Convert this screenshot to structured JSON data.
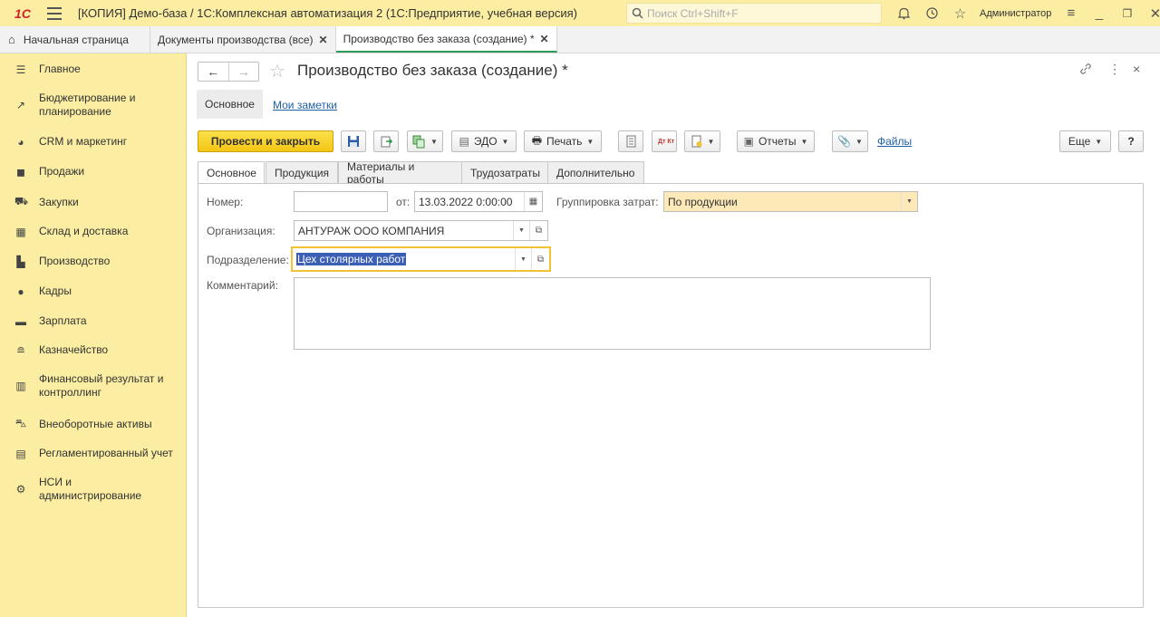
{
  "titlebar": {
    "logo": "1С",
    "title": "[КОПИЯ] Демо-база / 1С:Комплексная автоматизация 2  (1С:Предприятие, учебная версия)",
    "search_placeholder": "Поиск Ctrl+Shift+F",
    "username": "Администратор"
  },
  "tabs": [
    {
      "label": "Начальная страница"
    },
    {
      "label": "Документы производства (все)"
    },
    {
      "label": "Производство без заказа (создание) *"
    }
  ],
  "sidebar": {
    "items": [
      {
        "label": "Главное",
        "icon": "menu-lines-icon"
      },
      {
        "label": "Бюджетирование и планирование",
        "icon": "budget-chart-icon"
      },
      {
        "label": "CRM и маркетинг",
        "icon": "pie-chart-icon"
      },
      {
        "label": "Продажи",
        "icon": "shopping-bag-icon"
      },
      {
        "label": "Закупки",
        "icon": "cart-icon"
      },
      {
        "label": "Склад и доставка",
        "icon": "warehouse-grid-icon"
      },
      {
        "label": "Производство",
        "icon": "factory-icon"
      },
      {
        "label": "Кадры",
        "icon": "person-icon"
      },
      {
        "label": "Зарплата",
        "icon": "money-card-icon"
      },
      {
        "label": "Казначейство",
        "icon": "coins-icon"
      },
      {
        "label": "Финансовый результат и контроллинг",
        "icon": "bar-chart-icon"
      },
      {
        "label": "Внеоборотные активы",
        "icon": "car-icon"
      },
      {
        "label": "Регламентированный учет",
        "icon": "ledger-icon"
      },
      {
        "label": "НСИ и администрирование",
        "icon": "gear-icon"
      }
    ]
  },
  "form": {
    "title": "Производство без заказа (создание) *",
    "subnav_main": "Основное",
    "subnav_notes": "Мои заметки",
    "toolbar": {
      "post_close": "Провести и закрыть",
      "edo": "ЭДО",
      "print": "Печать",
      "reports": "Отчеты",
      "files": "Файлы",
      "more": "Еще",
      "help": "?",
      "dt_kt": "Дт Кт"
    },
    "tabs": [
      "Основное",
      "Продукция",
      "Материалы и работы",
      "Трудозатраты",
      "Дополнительно"
    ],
    "fields": {
      "number_label": "Номер:",
      "number_value": "",
      "date_label": "от:",
      "date_value": "13.03.2022  0:00:00",
      "grouping_label": "Группировка затрат:",
      "grouping_value": "По продукции",
      "org_label": "Организация:",
      "org_value": "АНТУРАЖ ООО КОМПАНИЯ",
      "dept_label": "Подразделение:",
      "dept_value": "Цех столярных работ",
      "comment_label": "Комментарий:",
      "comment_value": ""
    }
  },
  "colors": {
    "titlebar_bg": "#fbeda2",
    "primary_button": "#f4c515",
    "link": "#1f5fa8",
    "active_tab_underline": "#2d9b5a",
    "selection": "#3b5fb5"
  }
}
